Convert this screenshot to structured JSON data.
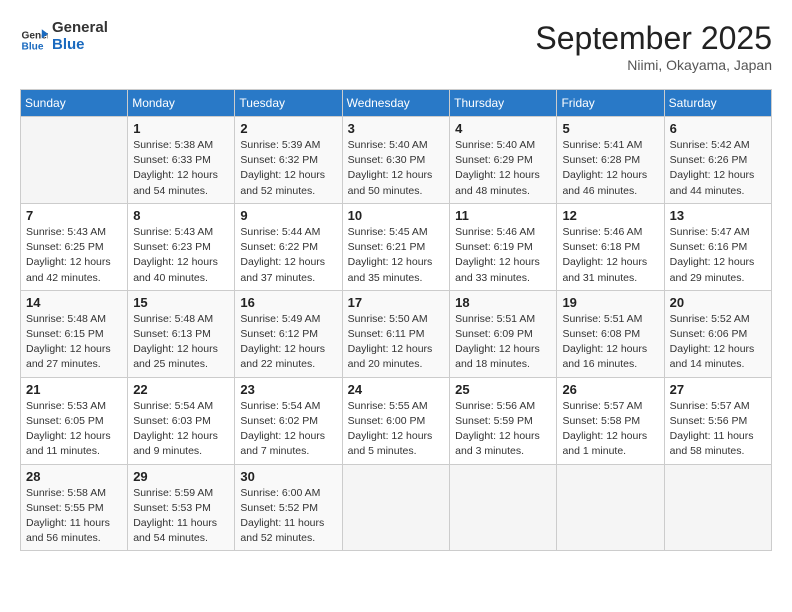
{
  "header": {
    "logo_line1": "General",
    "logo_line2": "Blue",
    "month": "September 2025",
    "location": "Niimi, Okayama, Japan"
  },
  "days_of_week": [
    "Sunday",
    "Monday",
    "Tuesday",
    "Wednesday",
    "Thursday",
    "Friday",
    "Saturday"
  ],
  "weeks": [
    [
      {
        "day": "",
        "info": ""
      },
      {
        "day": "1",
        "info": "Sunrise: 5:38 AM\nSunset: 6:33 PM\nDaylight: 12 hours\nand 54 minutes."
      },
      {
        "day": "2",
        "info": "Sunrise: 5:39 AM\nSunset: 6:32 PM\nDaylight: 12 hours\nand 52 minutes."
      },
      {
        "day": "3",
        "info": "Sunrise: 5:40 AM\nSunset: 6:30 PM\nDaylight: 12 hours\nand 50 minutes."
      },
      {
        "day": "4",
        "info": "Sunrise: 5:40 AM\nSunset: 6:29 PM\nDaylight: 12 hours\nand 48 minutes."
      },
      {
        "day": "5",
        "info": "Sunrise: 5:41 AM\nSunset: 6:28 PM\nDaylight: 12 hours\nand 46 minutes."
      },
      {
        "day": "6",
        "info": "Sunrise: 5:42 AM\nSunset: 6:26 PM\nDaylight: 12 hours\nand 44 minutes."
      }
    ],
    [
      {
        "day": "7",
        "info": "Sunrise: 5:43 AM\nSunset: 6:25 PM\nDaylight: 12 hours\nand 42 minutes."
      },
      {
        "day": "8",
        "info": "Sunrise: 5:43 AM\nSunset: 6:23 PM\nDaylight: 12 hours\nand 40 minutes."
      },
      {
        "day": "9",
        "info": "Sunrise: 5:44 AM\nSunset: 6:22 PM\nDaylight: 12 hours\nand 37 minutes."
      },
      {
        "day": "10",
        "info": "Sunrise: 5:45 AM\nSunset: 6:21 PM\nDaylight: 12 hours\nand 35 minutes."
      },
      {
        "day": "11",
        "info": "Sunrise: 5:46 AM\nSunset: 6:19 PM\nDaylight: 12 hours\nand 33 minutes."
      },
      {
        "day": "12",
        "info": "Sunrise: 5:46 AM\nSunset: 6:18 PM\nDaylight: 12 hours\nand 31 minutes."
      },
      {
        "day": "13",
        "info": "Sunrise: 5:47 AM\nSunset: 6:16 PM\nDaylight: 12 hours\nand 29 minutes."
      }
    ],
    [
      {
        "day": "14",
        "info": "Sunrise: 5:48 AM\nSunset: 6:15 PM\nDaylight: 12 hours\nand 27 minutes."
      },
      {
        "day": "15",
        "info": "Sunrise: 5:48 AM\nSunset: 6:13 PM\nDaylight: 12 hours\nand 25 minutes."
      },
      {
        "day": "16",
        "info": "Sunrise: 5:49 AM\nSunset: 6:12 PM\nDaylight: 12 hours\nand 22 minutes."
      },
      {
        "day": "17",
        "info": "Sunrise: 5:50 AM\nSunset: 6:11 PM\nDaylight: 12 hours\nand 20 minutes."
      },
      {
        "day": "18",
        "info": "Sunrise: 5:51 AM\nSunset: 6:09 PM\nDaylight: 12 hours\nand 18 minutes."
      },
      {
        "day": "19",
        "info": "Sunrise: 5:51 AM\nSunset: 6:08 PM\nDaylight: 12 hours\nand 16 minutes."
      },
      {
        "day": "20",
        "info": "Sunrise: 5:52 AM\nSunset: 6:06 PM\nDaylight: 12 hours\nand 14 minutes."
      }
    ],
    [
      {
        "day": "21",
        "info": "Sunrise: 5:53 AM\nSunset: 6:05 PM\nDaylight: 12 hours\nand 11 minutes."
      },
      {
        "day": "22",
        "info": "Sunrise: 5:54 AM\nSunset: 6:03 PM\nDaylight: 12 hours\nand 9 minutes."
      },
      {
        "day": "23",
        "info": "Sunrise: 5:54 AM\nSunset: 6:02 PM\nDaylight: 12 hours\nand 7 minutes."
      },
      {
        "day": "24",
        "info": "Sunrise: 5:55 AM\nSunset: 6:00 PM\nDaylight: 12 hours\nand 5 minutes."
      },
      {
        "day": "25",
        "info": "Sunrise: 5:56 AM\nSunset: 5:59 PM\nDaylight: 12 hours\nand 3 minutes."
      },
      {
        "day": "26",
        "info": "Sunrise: 5:57 AM\nSunset: 5:58 PM\nDaylight: 12 hours\nand 1 minute."
      },
      {
        "day": "27",
        "info": "Sunrise: 5:57 AM\nSunset: 5:56 PM\nDaylight: 11 hours\nand 58 minutes."
      }
    ],
    [
      {
        "day": "28",
        "info": "Sunrise: 5:58 AM\nSunset: 5:55 PM\nDaylight: 11 hours\nand 56 minutes."
      },
      {
        "day": "29",
        "info": "Sunrise: 5:59 AM\nSunset: 5:53 PM\nDaylight: 11 hours\nand 54 minutes."
      },
      {
        "day": "30",
        "info": "Sunrise: 6:00 AM\nSunset: 5:52 PM\nDaylight: 11 hours\nand 52 minutes."
      },
      {
        "day": "",
        "info": ""
      },
      {
        "day": "",
        "info": ""
      },
      {
        "day": "",
        "info": ""
      },
      {
        "day": "",
        "info": ""
      }
    ]
  ]
}
